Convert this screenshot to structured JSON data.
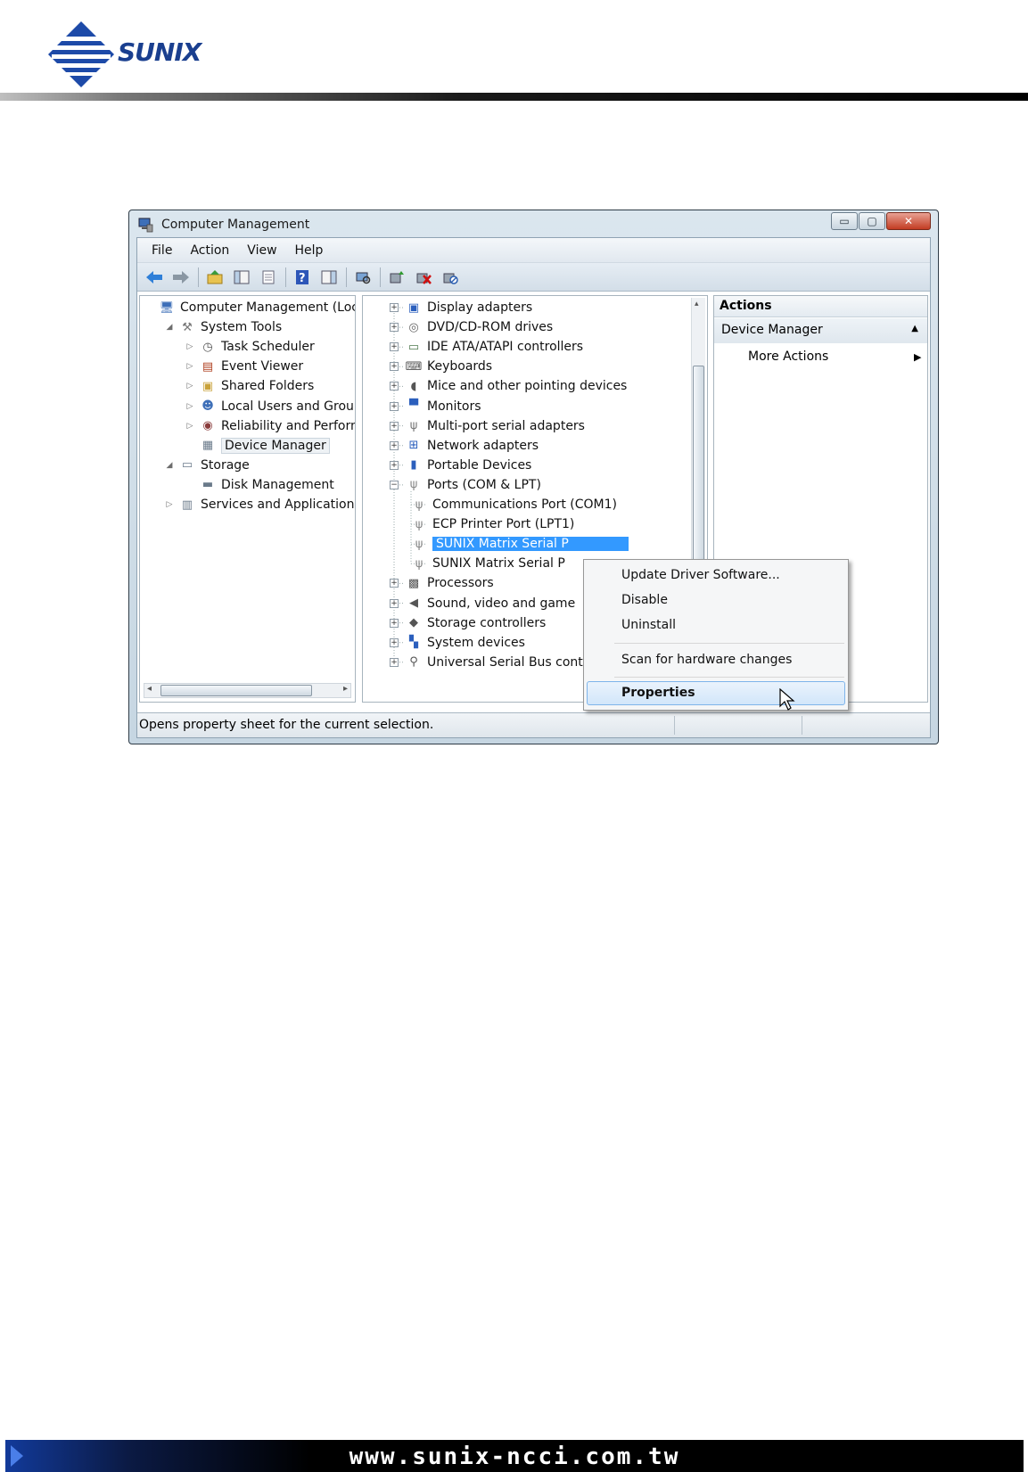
{
  "brand": {
    "name": "SUNIX"
  },
  "window": {
    "title": "Computer Management",
    "controls": {
      "minimize": "▭",
      "maximize": "▢",
      "close": "✕"
    }
  },
  "menu": [
    "File",
    "Action",
    "View",
    "Help"
  ],
  "toolbar_icons": [
    "back-icon",
    "forward-icon",
    "up-folder-icon",
    "show-hide-tree-icon",
    "properties-sheet-icon",
    "help-icon",
    "show-hide-action-pane-icon",
    "scan-hardware-icon",
    "update-driver-icon",
    "uninstall-icon",
    "disable-icon"
  ],
  "left_tree": [
    {
      "label": "Computer Management (Local",
      "exp": "",
      "indent": 0,
      "icon": "computer-icon"
    },
    {
      "label": "System Tools",
      "exp": "◢",
      "indent": 1,
      "icon": "tools-icon"
    },
    {
      "label": "Task Scheduler",
      "exp": "▷",
      "indent": 2,
      "icon": "clock-icon"
    },
    {
      "label": "Event Viewer",
      "exp": "▷",
      "indent": 2,
      "icon": "event-viewer-icon"
    },
    {
      "label": "Shared Folders",
      "exp": "▷",
      "indent": 2,
      "icon": "shared-folder-icon"
    },
    {
      "label": "Local Users and Groups",
      "exp": "▷",
      "indent": 2,
      "icon": "users-icon"
    },
    {
      "label": "Reliability and Performa",
      "exp": "▷",
      "indent": 2,
      "icon": "performance-icon"
    },
    {
      "label": "Device Manager",
      "exp": "",
      "indent": 2,
      "icon": "device-manager-icon",
      "selected": true
    },
    {
      "label": "Storage",
      "exp": "◢",
      "indent": 1,
      "icon": "storage-icon"
    },
    {
      "label": "Disk Management",
      "exp": "",
      "indent": 2,
      "icon": "disk-icon"
    },
    {
      "label": "Services and Applications",
      "exp": "▷",
      "indent": 1,
      "icon": "services-icon"
    }
  ],
  "device_tree": [
    {
      "label": "Display adapters",
      "pm": "+",
      "indent": 0,
      "icon": "display-adapter-icon"
    },
    {
      "label": "DVD/CD-ROM drives",
      "pm": "+",
      "indent": 0,
      "icon": "dvd-icon"
    },
    {
      "label": "IDE ATA/ATAPI controllers",
      "pm": "+",
      "indent": 0,
      "icon": "ide-controller-icon"
    },
    {
      "label": "Keyboards",
      "pm": "+",
      "indent": 0,
      "icon": "keyboard-icon"
    },
    {
      "label": "Mice and other pointing devices",
      "pm": "+",
      "indent": 0,
      "icon": "mouse-icon"
    },
    {
      "label": "Monitors",
      "pm": "+",
      "indent": 0,
      "icon": "monitor-icon"
    },
    {
      "label": "Multi-port serial adapters",
      "pm": "+",
      "indent": 0,
      "icon": "serial-port-icon"
    },
    {
      "label": "Network adapters",
      "pm": "+",
      "indent": 0,
      "icon": "network-adapter-icon"
    },
    {
      "label": "Portable Devices",
      "pm": "+",
      "indent": 0,
      "icon": "portable-device-icon"
    },
    {
      "label": "Ports (COM & LPT)",
      "pm": "−",
      "indent": 0,
      "icon": "port-icon"
    },
    {
      "label": "Communications Port (COM1)",
      "pm": "",
      "indent": 1,
      "icon": "port-icon"
    },
    {
      "label": "ECP Printer Port (LPT1)",
      "pm": "",
      "indent": 1,
      "icon": "port-icon"
    },
    {
      "label": "SUNIX Matrix Serial P",
      "pm": "",
      "indent": 1,
      "icon": "port-icon",
      "selected": true
    },
    {
      "label": "SUNIX Matrix Serial P",
      "pm": "",
      "indent": 1,
      "icon": "port-icon"
    },
    {
      "label": "Processors",
      "pm": "+",
      "indent": 0,
      "icon": "processor-icon"
    },
    {
      "label": "Sound, video and game",
      "pm": "+",
      "indent": 0,
      "icon": "sound-icon"
    },
    {
      "label": "Storage controllers",
      "pm": "+",
      "indent": 0,
      "icon": "storage-controller-icon"
    },
    {
      "label": "System devices",
      "pm": "+",
      "indent": 0,
      "icon": "system-device-icon"
    },
    {
      "label": "Universal Serial Bus contr",
      "pm": "+",
      "indent": 0,
      "icon": "usb-icon"
    }
  ],
  "actions": {
    "header": "Actions",
    "section": "Device Manager",
    "more": "More Actions"
  },
  "context_menu": {
    "update_driver": "Update Driver Software...",
    "disable": "Disable",
    "uninstall": "Uninstall",
    "scan": "Scan for hardware changes",
    "properties": "Properties"
  },
  "status": "Opens property sheet for the current selection.",
  "footer": {
    "url": "www.sunix-ncci.com.tw"
  }
}
